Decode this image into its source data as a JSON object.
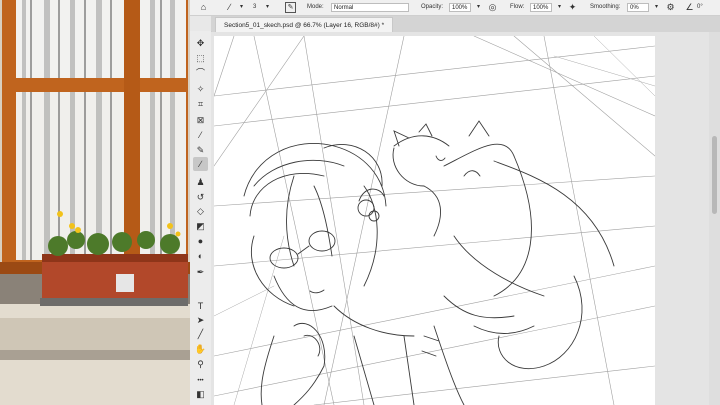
{
  "options_bar": {
    "mode_label": "Mode:",
    "mode_value": "Normal",
    "opacity_label": "Opacity:",
    "opacity_value": "100%",
    "flow_label": "Flow:",
    "flow_value": "100%",
    "smoothing_label": "Smoothing:",
    "smoothing_value": "0%",
    "angle_value": "0°",
    "brush_size": "3"
  },
  "document_tab": {
    "title": "Section5_01_skech.psd @ 66.7% (Layer 16, RGB/8#) *"
  },
  "tools": [
    {
      "name": "move-tool",
      "glyph": "✥"
    },
    {
      "name": "marquee-tool",
      "glyph": "⬚"
    },
    {
      "name": "lasso-tool",
      "glyph": "⌒"
    },
    {
      "name": "magic-wand-tool",
      "glyph": "✧"
    },
    {
      "name": "crop-tool",
      "glyph": "⌗"
    },
    {
      "name": "frame-tool",
      "glyph": "⊠"
    },
    {
      "name": "eyedropper-tool",
      "glyph": "⁄"
    },
    {
      "name": "healing-brush-tool",
      "glyph": "✎"
    },
    {
      "name": "brush-tool",
      "glyph": "∕"
    },
    {
      "name": "clone-stamp-tool",
      "glyph": "♟"
    },
    {
      "name": "history-brush-tool",
      "glyph": "↺"
    },
    {
      "name": "eraser-tool",
      "glyph": "◇"
    },
    {
      "name": "gradient-tool",
      "glyph": "◩"
    },
    {
      "name": "blur-tool",
      "glyph": "●"
    },
    {
      "name": "dodge-tool",
      "glyph": "◐"
    },
    {
      "name": "pen-tool",
      "glyph": "✒"
    },
    {
      "name": "type-tool",
      "glyph": "T"
    },
    {
      "name": "path-selection-tool",
      "glyph": "➤"
    },
    {
      "name": "line-tool",
      "glyph": "╱"
    },
    {
      "name": "hand-tool",
      "glyph": "✋"
    },
    {
      "name": "zoom-tool",
      "glyph": "⚲"
    },
    {
      "name": "more-tools",
      "glyph": "•••"
    },
    {
      "name": "color-swatches",
      "glyph": "◧"
    }
  ],
  "icons": {
    "home": "home-icon",
    "brush_preset": "brush-icon",
    "brush_settings": "brush-settings-icon",
    "airbrush": "airbrush-icon",
    "pressure_size": "pressure-icon",
    "settings": "gear-icon",
    "angle": "angle-icon"
  }
}
